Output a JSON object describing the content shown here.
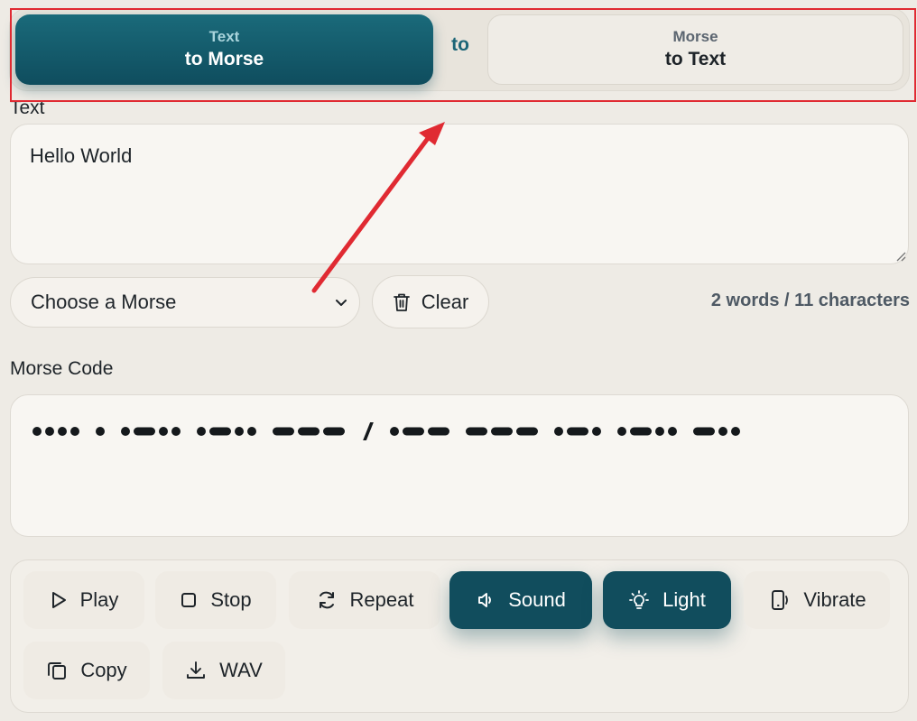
{
  "mode_switch": {
    "active": {
      "small": "Text",
      "big": "to Morse"
    },
    "separator": "to",
    "inactive": {
      "small": "Morse",
      "big": "to Text"
    }
  },
  "text_section": {
    "label": "Text",
    "value": "Hello World"
  },
  "controls": {
    "select_value": "Choose a Morse",
    "clear_label": "Clear",
    "counts": "2 words / 11 characters"
  },
  "morse_section": {
    "label": "Morse Code",
    "code": ".... . .-.. .-.. --- / .-- --- .-. .-.. -.."
  },
  "actions": {
    "play": "Play",
    "stop": "Stop",
    "repeat": "Repeat",
    "sound": "Sound",
    "light": "Light",
    "vibrate": "Vibrate",
    "copy": "Copy",
    "wav": "WAV"
  },
  "colors": {
    "accent": "#114d5d",
    "annotation": "#e02a32"
  }
}
